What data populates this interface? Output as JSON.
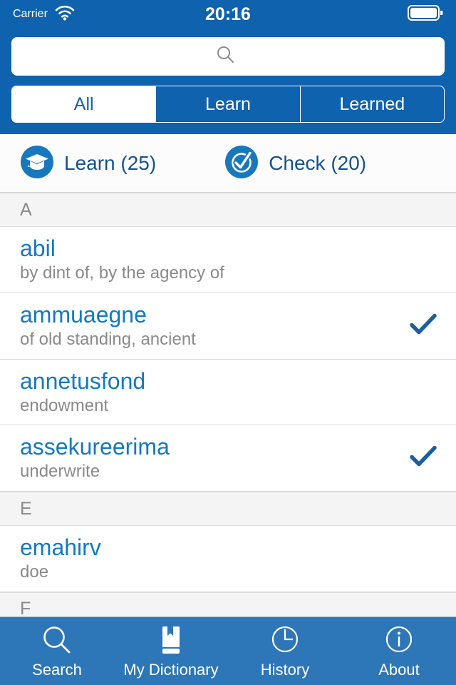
{
  "status_bar": {
    "carrier": "Carrier",
    "time": "20:16",
    "wifi_icon": "wifi-icon",
    "battery_icon": "battery-full-icon"
  },
  "search": {
    "value": "",
    "placeholder": "",
    "icon": "search-icon"
  },
  "segments": [
    {
      "label": "All",
      "selected": true
    },
    {
      "label": "Learn",
      "selected": false
    },
    {
      "label": "Learned",
      "selected": false
    }
  ],
  "actions": [
    {
      "label": "Learn (25)",
      "icon": "graduation-cap-icon"
    },
    {
      "label": "Check (20)",
      "icon": "check-circle-icon"
    }
  ],
  "sections": [
    {
      "letter": "A",
      "entries": [
        {
          "term": "abil",
          "definition": "by dint of, by the agency of",
          "checked": false
        },
        {
          "term": "ammuaegne",
          "definition": "of old standing, ancient",
          "checked": true
        },
        {
          "term": "annetusfond",
          "definition": "endowment",
          "checked": false
        },
        {
          "term": "assekureerima",
          "definition": "underwrite",
          "checked": true
        }
      ]
    },
    {
      "letter": "E",
      "entries": [
        {
          "term": "emahirv",
          "definition": "doe",
          "checked": false
        }
      ]
    },
    {
      "letter": "F",
      "entries": []
    }
  ],
  "tabs": [
    {
      "label": "Search",
      "icon": "search-icon"
    },
    {
      "label": "My Dictionary",
      "icon": "book-icon"
    },
    {
      "label": "History",
      "icon": "clock-icon"
    },
    {
      "label": "About",
      "icon": "info-circle-icon"
    }
  ],
  "colors": {
    "header_blue": "#0F62AD",
    "tabbar_blue": "#2D76B8",
    "term_blue": "#1379C4",
    "action_blue": "#15538F",
    "checkmark_blue": "#1B5FA3",
    "gray_text": "#8A8A8A",
    "section_bg": "#F4F4F4"
  }
}
